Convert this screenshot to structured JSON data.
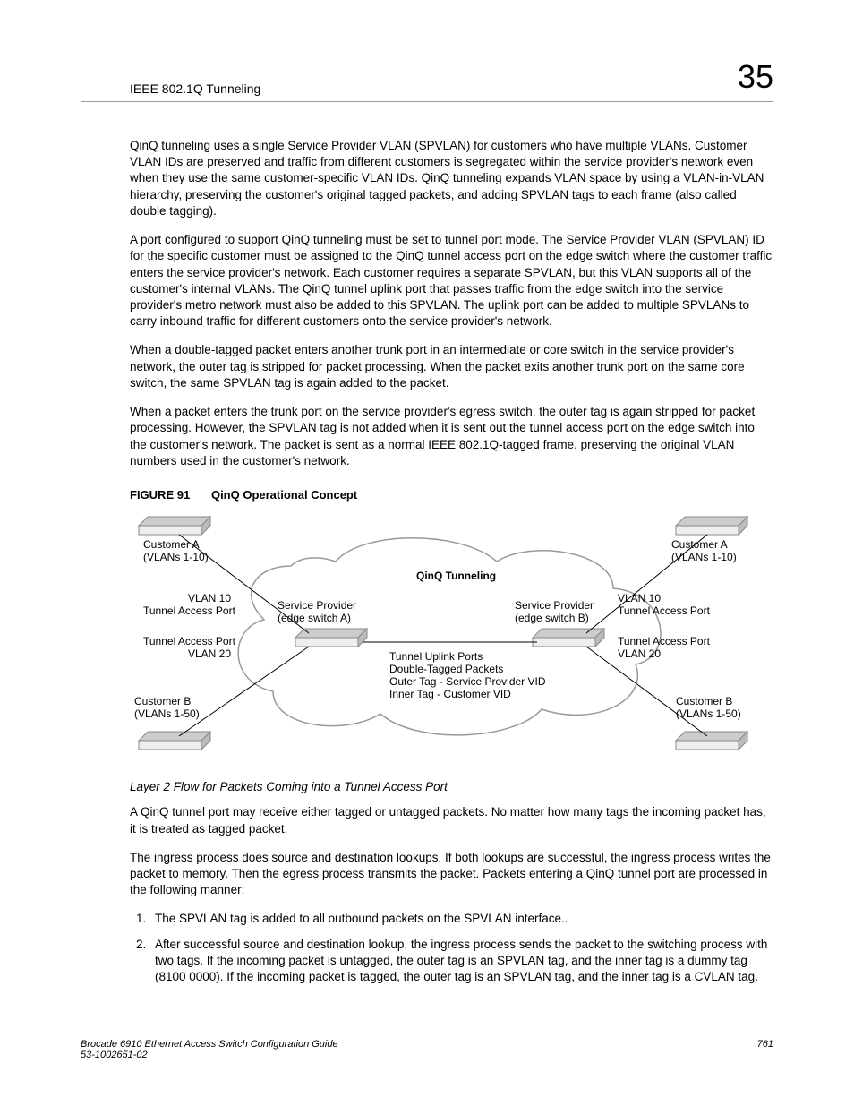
{
  "header": {
    "section": "IEEE 802.1Q Tunneling",
    "chapter": "35"
  },
  "paragraphs": {
    "p1": "QinQ tunneling uses a single Service Provider VLAN (SPVLAN) for customers who have multiple VLANs. Customer VLAN IDs are preserved and traffic from different customers is segregated within the service provider's network even when they use the same customer-specific VLAN IDs. QinQ tunneling expands VLAN space by using a VLAN-in-VLAN hierarchy, preserving the customer's original tagged packets, and adding SPVLAN tags to each frame (also called double tagging).",
    "p2": "A port configured to support QinQ tunneling must be set to tunnel port mode. The Service Provider VLAN (SPVLAN) ID for the specific customer must be assigned to the QinQ tunnel access port on the edge switch where the customer traffic enters the service provider's network. Each customer requires a separate SPVLAN, but this VLAN supports all of the customer's internal VLANs. The QinQ tunnel uplink port that passes traffic from the edge switch into the service provider's metro network must also be added to this SPVLAN. The uplink port can be added to multiple SPVLANs to carry inbound traffic for different customers onto the service provider's network.",
    "p3": "When a double-tagged packet enters another trunk port in an intermediate or core switch in the service provider's network, the outer tag is stripped for packet processing. When the packet exits another trunk port on the same core switch, the same SPVLAN tag is again added to the packet.",
    "p4": "When a packet enters the trunk port on the service provider's egress switch, the outer tag is again stripped for packet processing. However, the SPVLAN tag is not added when it is sent out the tunnel access port on the edge switch into the customer's network. The packet is sent as a normal IEEE 802.1Q-tagged frame, preserving the original VLAN numbers used in the customer's network."
  },
  "figure": {
    "label": "FIGURE 91",
    "title": "QinQ Operational Concept"
  },
  "diagram": {
    "qinq": "QinQ Tunneling",
    "custA_l1": "Customer A",
    "custA_l2": "(VLANs 1-10)",
    "custB_l1": "Customer B",
    "custB_l2": "(VLANs 1-50)",
    "vlan10": "VLAN 10",
    "vlan20": "VLAN 20",
    "tap": "Tunnel Access Port",
    "spA1": "Service Provider",
    "spA2": "(edge switch A)",
    "spB1": "Service Provider",
    "spB2": "(edge switch B)",
    "upl1": "Tunnel Uplink Ports",
    "upl2": "Double-Tagged Packets",
    "upl3": "Outer Tag - Service Provider VID",
    "upl4": "Inner Tag - Customer VID"
  },
  "subhead": "Layer 2 Flow for Packets Coming into a Tunnel Access Port",
  "paragraphs2": {
    "p5": "A QinQ tunnel port may receive either tagged or untagged packets. No matter how many tags the incoming packet has, it is treated as tagged packet.",
    "p6": "The ingress process does source and destination lookups. If both lookups are successful, the ingress process writes the packet to memory. Then the egress process transmits the packet. Packets entering a QinQ tunnel port are processed in the following manner:"
  },
  "list": {
    "i1": "The SPVLAN tag is added to all outbound packets on the SPVLAN interface..",
    "i2": "After successful source and destination lookup, the ingress process sends the packet to the switching process with two tags. If the incoming packet is untagged, the outer tag is an SPVLAN tag, and the inner tag is a dummy tag (8100 0000). If the incoming packet is tagged, the outer tag is an SPVLAN tag, and the inner tag is a CVLAN tag."
  },
  "footer": {
    "book": "Brocade 6910 Ethernet Access Switch Configuration Guide",
    "docnum": "53-1002651-02",
    "page": "761"
  }
}
